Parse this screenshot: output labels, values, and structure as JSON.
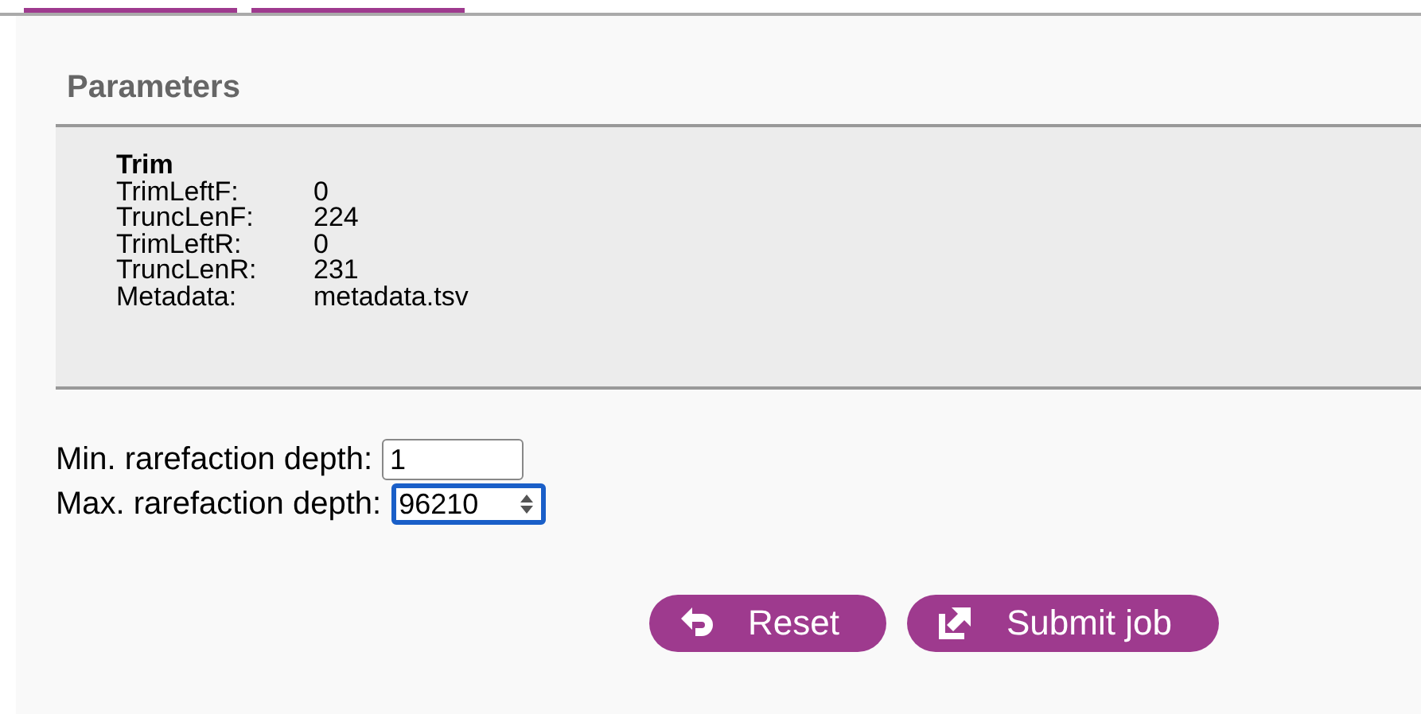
{
  "tabs": [
    {
      "selected": true
    },
    {
      "selected": true
    }
  ],
  "parameters": {
    "title": "Parameters",
    "group": "Trim",
    "rows": [
      {
        "label": "TrimLeftF:",
        "value": "0"
      },
      {
        "label": "TruncLenF:",
        "value": "224"
      },
      {
        "label": "TrimLeftR:",
        "value": "0"
      },
      {
        "label": "TruncLenR:",
        "value": "231"
      },
      {
        "label": "Metadata:",
        "value": "metadata.tsv"
      }
    ]
  },
  "fields": [
    {
      "label": "Min. rarefaction depth:",
      "value": "1",
      "kind": "text",
      "focused": false
    },
    {
      "label": "Max. rarefaction depth:",
      "value": "96210",
      "kind": "number",
      "focused": true
    }
  ],
  "buttons": [
    {
      "label": "Reset",
      "kind": "reset"
    },
    {
      "label": "Submit job",
      "kind": "submit"
    }
  ]
}
